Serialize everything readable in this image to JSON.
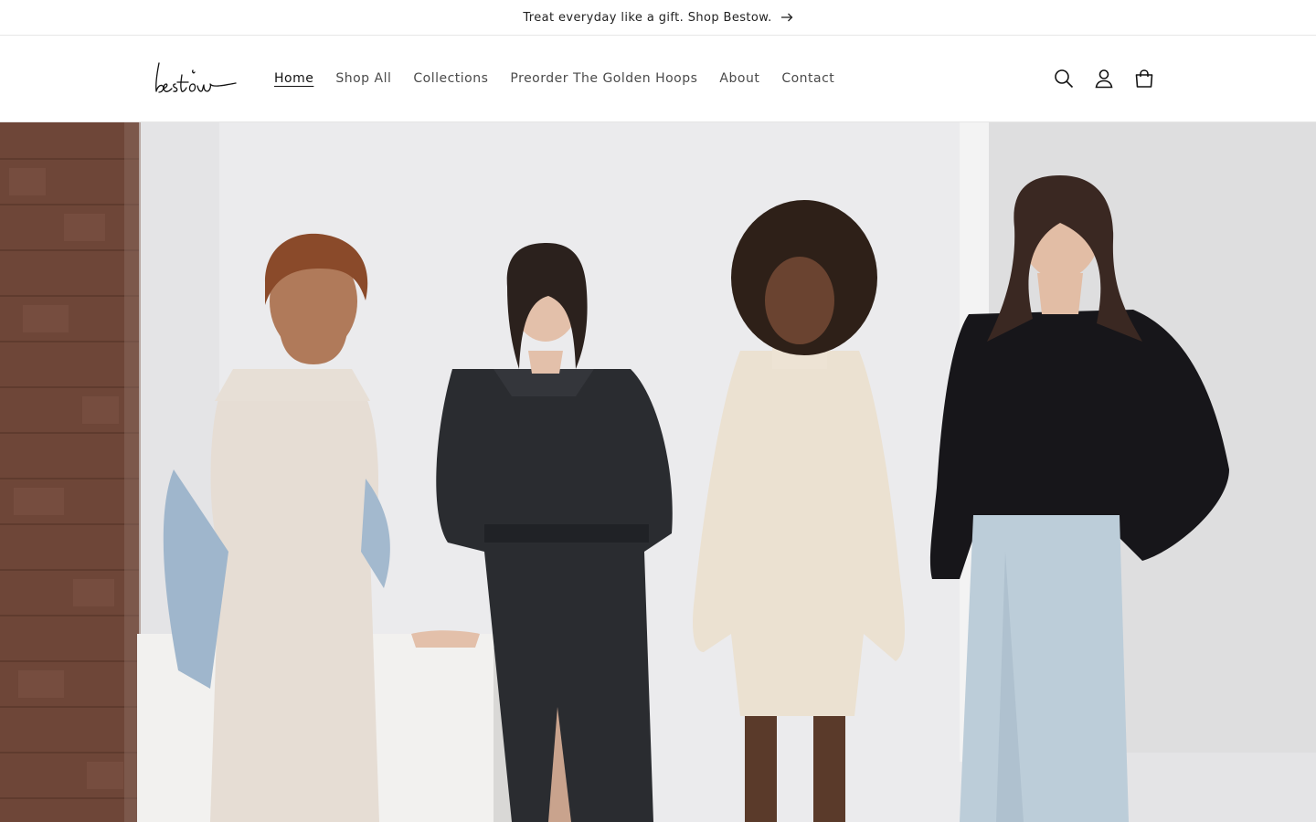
{
  "announcement": {
    "text": "Treat everyday like a gift. Shop Bestow.",
    "icon": "arrow-right-icon"
  },
  "header": {
    "logo_text": "bestow",
    "nav": [
      {
        "label": "Home",
        "active": true
      },
      {
        "label": "Shop All",
        "active": false
      },
      {
        "label": "Collections",
        "active": false
      },
      {
        "label": "Preorder The Golden Hoops",
        "active": false
      },
      {
        "label": "About",
        "active": false
      },
      {
        "label": "Contact",
        "active": false
      }
    ],
    "icons": [
      "search-icon",
      "account-icon",
      "cart-icon"
    ]
  },
  "hero": {
    "image": "four women posing in studio against white wall and brick column",
    "colors": {
      "wall": "#e7e7e9",
      "brick": "#6b4235",
      "block": "#f1f0ee"
    }
  }
}
